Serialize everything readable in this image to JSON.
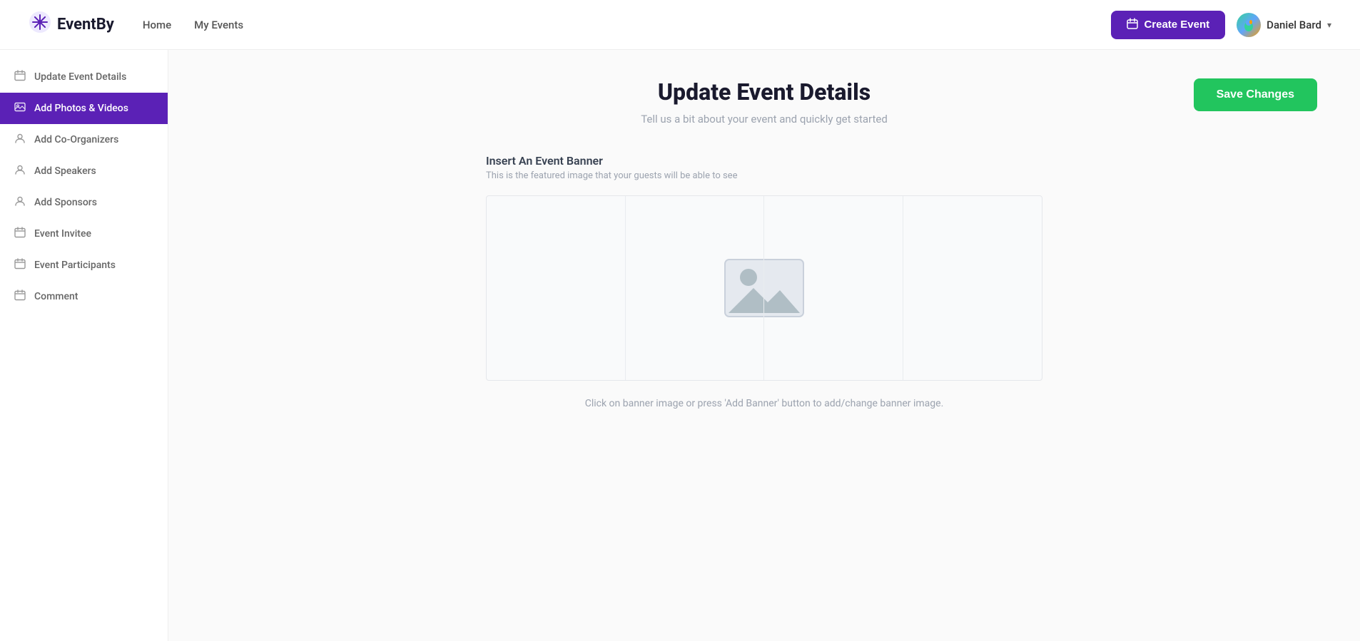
{
  "navbar": {
    "logo_text": "EventBy",
    "logo_icon": "❄",
    "nav_links": [
      {
        "label": "Home",
        "href": "#"
      },
      {
        "label": "My Events",
        "href": "#"
      }
    ],
    "create_event_label": "Create Event",
    "user_name": "Daniel Bard"
  },
  "sidebar": {
    "items": [
      {
        "id": "update-event-details",
        "label": "Update Event Details",
        "icon": "calendar",
        "active": false
      },
      {
        "id": "add-photos-videos",
        "label": "Add Photos & Videos",
        "icon": "photo",
        "active": true
      },
      {
        "id": "add-co-organizers",
        "label": "Add Co-Organizers",
        "icon": "person",
        "active": false
      },
      {
        "id": "add-speakers",
        "label": "Add Speakers",
        "icon": "person",
        "active": false
      },
      {
        "id": "add-sponsors",
        "label": "Add Sponsors",
        "icon": "person",
        "active": false
      },
      {
        "id": "event-invitee",
        "label": "Event Invitee",
        "icon": "calendar",
        "active": false
      },
      {
        "id": "event-participants",
        "label": "Event Participants",
        "icon": "calendar",
        "active": false
      },
      {
        "id": "comment",
        "label": "Comment",
        "icon": "calendar",
        "active": false
      }
    ]
  },
  "main": {
    "save_changes_label": "Save Changes",
    "page_title": "Update Event Details",
    "page_subtitle": "Tell us a bit about your event and quickly get started",
    "banner_section_label": "Insert An Event Banner",
    "banner_section_desc": "This is the featured image that your guests will be able to see",
    "banner_hint": "Click on banner image or press 'Add Banner' button to add/change banner image."
  }
}
